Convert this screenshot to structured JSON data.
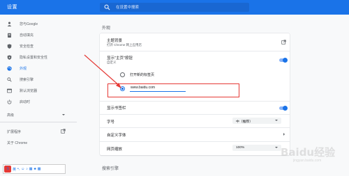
{
  "app": {
    "title": "设置"
  },
  "search": {
    "placeholder": "在设置中搜索"
  },
  "sidebar": {
    "items": [
      {
        "label": "您与Google",
        "icon": "person-icon"
      },
      {
        "label": "自动填充",
        "icon": "clipboard-icon"
      },
      {
        "label": "安全检查",
        "icon": "shield-icon"
      },
      {
        "label": "隐私设置和安全性",
        "icon": "shield-lock-icon"
      },
      {
        "label": "外观",
        "icon": "palette-icon",
        "active": true
      },
      {
        "label": "搜索引擎",
        "icon": "search-icon"
      },
      {
        "label": "默认浏览器",
        "icon": "browser-icon"
      },
      {
        "label": "启动时",
        "icon": "power-icon"
      }
    ],
    "advanced": "高级",
    "extensions": "扩展程序",
    "about": "关于 Chrome"
  },
  "appearance": {
    "section_title": "外观",
    "theme": {
      "title": "主题背景",
      "subtitle": "打开 Chrome 网上应用店"
    },
    "home_button": {
      "title": "显示\"主页\"按钮",
      "subtitle": "自定义",
      "enabled": true
    },
    "radio_new_tab": "打开新的标签页",
    "url_value": "www.baidu.com",
    "bookmarks_bar": {
      "title": "显示书签栏",
      "enabled": true
    },
    "font_size": {
      "title": "字号",
      "value": "中（推荐）"
    },
    "custom_fonts": {
      "title": "自定义字体"
    },
    "page_zoom": {
      "title": "网页缩放",
      "value": "100%"
    }
  },
  "search_engine_section": {
    "title": "搜索引擎"
  },
  "ime": {
    "logo": "S",
    "label": "英"
  },
  "watermark": {
    "text": "Baidu经验",
    "sub": "jingyan.baidu.com"
  },
  "colors": {
    "accent": "#1a73e8",
    "highlight": "#e53935"
  }
}
